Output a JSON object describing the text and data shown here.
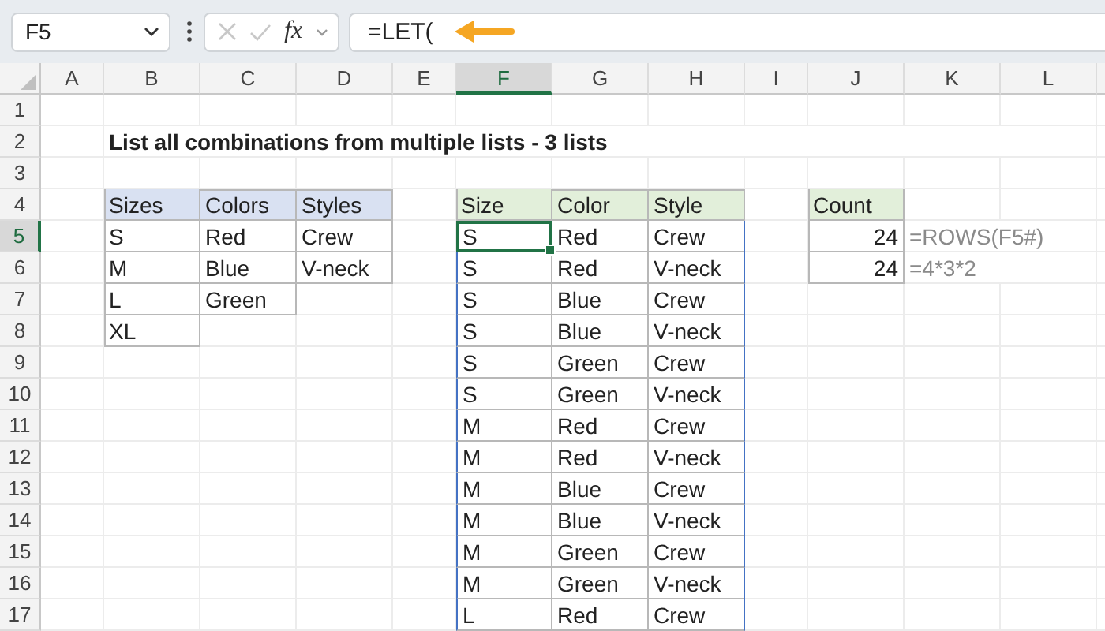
{
  "formula_bar": {
    "name_box": "F5",
    "function_label": "fx",
    "formula": "=LET("
  },
  "columns": [
    {
      "label": "A",
      "selected": false
    },
    {
      "label": "B",
      "selected": false
    },
    {
      "label": "C",
      "selected": false
    },
    {
      "label": "D",
      "selected": false
    },
    {
      "label": "E",
      "selected": false
    },
    {
      "label": "F",
      "selected": true
    },
    {
      "label": "G",
      "selected": false
    },
    {
      "label": "H",
      "selected": false
    },
    {
      "label": "I",
      "selected": false
    },
    {
      "label": "J",
      "selected": false
    },
    {
      "label": "K",
      "selected": false
    },
    {
      "label": "L",
      "selected": false
    }
  ],
  "rows": [
    {
      "label": "1",
      "selected": false,
      "cells": [
        null,
        null,
        null,
        null,
        null,
        null,
        null,
        null,
        null,
        null,
        null,
        null
      ]
    },
    {
      "label": "2",
      "selected": false,
      "cells": [
        null,
        {
          "text": "List all combinations from multiple lists - 3 lists",
          "kind": "title",
          "selected": false
        },
        null,
        null,
        null,
        null,
        null,
        null,
        null,
        null,
        null,
        null
      ]
    },
    {
      "label": "3",
      "selected": false,
      "cells": [
        null,
        null,
        null,
        null,
        null,
        null,
        null,
        null,
        null,
        null,
        null,
        null
      ]
    },
    {
      "label": "4",
      "selected": false,
      "cells": [
        null,
        {
          "text": "Sizes",
          "kind": "input_header",
          "selected": false
        },
        {
          "text": "Colors",
          "kind": "input_header",
          "selected": false
        },
        {
          "text": "Styles",
          "kind": "input_header",
          "selected": false
        },
        null,
        {
          "text": "Size",
          "kind": "output_header",
          "selected": false
        },
        {
          "text": "Color",
          "kind": "output_header",
          "selected": false
        },
        {
          "text": "Style",
          "kind": "output_header",
          "selected": false
        },
        null,
        {
          "text": "Count",
          "kind": "output_header",
          "selected": false
        },
        null,
        null
      ]
    },
    {
      "label": "5",
      "selected": true,
      "cells": [
        null,
        {
          "text": "S",
          "kind": "input",
          "selected": false
        },
        {
          "text": "Red",
          "kind": "input",
          "selected": false
        },
        {
          "text": "Crew",
          "kind": "input",
          "selected": false
        },
        null,
        {
          "text": "S",
          "kind": "spill",
          "selected": true
        },
        {
          "text": "Red",
          "kind": "spill",
          "selected": false
        },
        {
          "text": "Crew",
          "kind": "spill",
          "selected": false
        },
        null,
        {
          "text": "24",
          "kind": "number",
          "selected": false
        },
        {
          "text": "=ROWS(F5#)",
          "kind": "note",
          "selected": false
        },
        null
      ]
    },
    {
      "label": "6",
      "selected": false,
      "cells": [
        null,
        {
          "text": "M",
          "kind": "input",
          "selected": false
        },
        {
          "text": "Blue",
          "kind": "input",
          "selected": false
        },
        {
          "text": "V-neck",
          "kind": "input",
          "selected": false
        },
        null,
        {
          "text": "S",
          "kind": "spill",
          "selected": false
        },
        {
          "text": "Red",
          "kind": "spill",
          "selected": false
        },
        {
          "text": "V-neck",
          "kind": "spill",
          "selected": false
        },
        null,
        {
          "text": "24",
          "kind": "number",
          "selected": false
        },
        {
          "text": "=4*3*2",
          "kind": "note",
          "selected": false
        },
        null
      ]
    },
    {
      "label": "7",
      "selected": false,
      "cells": [
        null,
        {
          "text": "L",
          "kind": "input",
          "selected": false
        },
        {
          "text": "Green",
          "kind": "input",
          "selected": false
        },
        null,
        null,
        {
          "text": "S",
          "kind": "spill",
          "selected": false
        },
        {
          "text": "Blue",
          "kind": "spill",
          "selected": false
        },
        {
          "text": "Crew",
          "kind": "spill",
          "selected": false
        },
        null,
        null,
        null,
        null
      ]
    },
    {
      "label": "8",
      "selected": false,
      "cells": [
        null,
        {
          "text": "XL",
          "kind": "input",
          "selected": false
        },
        null,
        null,
        null,
        {
          "text": "S",
          "kind": "spill",
          "selected": false
        },
        {
          "text": "Blue",
          "kind": "spill",
          "selected": false
        },
        {
          "text": "V-neck",
          "kind": "spill",
          "selected": false
        },
        null,
        null,
        null,
        null
      ]
    },
    {
      "label": "9",
      "selected": false,
      "cells": [
        null,
        null,
        null,
        null,
        null,
        {
          "text": "S",
          "kind": "spill",
          "selected": false
        },
        {
          "text": "Green",
          "kind": "spill",
          "selected": false
        },
        {
          "text": "Crew",
          "kind": "spill",
          "selected": false
        },
        null,
        null,
        null,
        null
      ]
    },
    {
      "label": "10",
      "selected": false,
      "cells": [
        null,
        null,
        null,
        null,
        null,
        {
          "text": "S",
          "kind": "spill",
          "selected": false
        },
        {
          "text": "Green",
          "kind": "spill",
          "selected": false
        },
        {
          "text": "V-neck",
          "kind": "spill",
          "selected": false
        },
        null,
        null,
        null,
        null
      ]
    },
    {
      "label": "11",
      "selected": false,
      "cells": [
        null,
        null,
        null,
        null,
        null,
        {
          "text": "M",
          "kind": "spill",
          "selected": false
        },
        {
          "text": "Red",
          "kind": "spill",
          "selected": false
        },
        {
          "text": "Crew",
          "kind": "spill",
          "selected": false
        },
        null,
        null,
        null,
        null
      ]
    },
    {
      "label": "12",
      "selected": false,
      "cells": [
        null,
        null,
        null,
        null,
        null,
        {
          "text": "M",
          "kind": "spill",
          "selected": false
        },
        {
          "text": "Red",
          "kind": "spill",
          "selected": false
        },
        {
          "text": "V-neck",
          "kind": "spill",
          "selected": false
        },
        null,
        null,
        null,
        null
      ]
    },
    {
      "label": "13",
      "selected": false,
      "cells": [
        null,
        null,
        null,
        null,
        null,
        {
          "text": "M",
          "kind": "spill",
          "selected": false
        },
        {
          "text": "Blue",
          "kind": "spill",
          "selected": false
        },
        {
          "text": "Crew",
          "kind": "spill",
          "selected": false
        },
        null,
        null,
        null,
        null
      ]
    },
    {
      "label": "14",
      "selected": false,
      "cells": [
        null,
        null,
        null,
        null,
        null,
        {
          "text": "M",
          "kind": "spill",
          "selected": false
        },
        {
          "text": "Blue",
          "kind": "spill",
          "selected": false
        },
        {
          "text": "V-neck",
          "kind": "spill",
          "selected": false
        },
        null,
        null,
        null,
        null
      ]
    },
    {
      "label": "15",
      "selected": false,
      "cells": [
        null,
        null,
        null,
        null,
        null,
        {
          "text": "M",
          "kind": "spill",
          "selected": false
        },
        {
          "text": "Green",
          "kind": "spill",
          "selected": false
        },
        {
          "text": "Crew",
          "kind": "spill",
          "selected": false
        },
        null,
        null,
        null,
        null
      ]
    },
    {
      "label": "16",
      "selected": false,
      "cells": [
        null,
        null,
        null,
        null,
        null,
        {
          "text": "M",
          "kind": "spill",
          "selected": false
        },
        {
          "text": "Green",
          "kind": "spill",
          "selected": false
        },
        {
          "text": "V-neck",
          "kind": "spill",
          "selected": false
        },
        null,
        null,
        null,
        null
      ]
    },
    {
      "label": "17",
      "selected": false,
      "cells": [
        null,
        null,
        null,
        null,
        null,
        {
          "text": "L",
          "kind": "spill",
          "selected": false
        },
        {
          "text": "Red",
          "kind": "spill",
          "selected": false
        },
        {
          "text": "Crew",
          "kind": "spill",
          "selected": false
        },
        null,
        null,
        null,
        null
      ]
    }
  ]
}
